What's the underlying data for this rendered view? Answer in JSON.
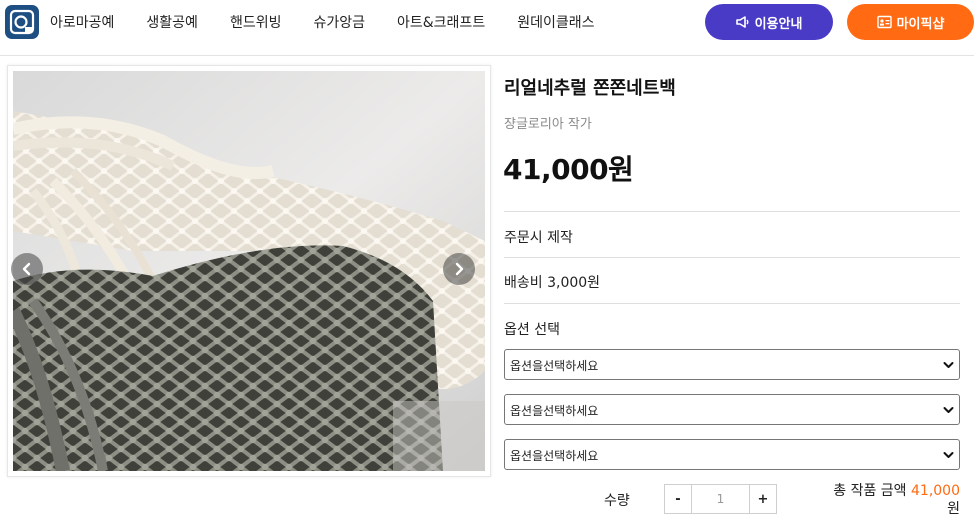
{
  "header": {
    "logo_icon": "camera-frame-icon",
    "nav": [
      "아로마공예",
      "생활공예",
      "핸드위빙",
      "슈가앙금",
      "아트&크래프트",
      "원데이클래스"
    ],
    "info_button": {
      "label": "이용안내",
      "icon": "megaphone-icon",
      "color": "#4a3bc6"
    },
    "mypick_button": {
      "label": "마이픽샵",
      "icon": "id-card-icon",
      "color": "#ff6a12"
    }
  },
  "gallery": {
    "prev_icon": "chevron-left-icon",
    "next_icon": "chevron-right-icon"
  },
  "product": {
    "title": "리얼네추럴 쫀쫀네트백",
    "artist": "쟝글로리아 작가",
    "price": "41,000원",
    "production": "주문시 제작",
    "shipping": "배송비 3,000원",
    "option_heading": "옵션 선택",
    "option_selects": [
      {
        "value": "옵션을선택하세요"
      },
      {
        "value": "옵션을선택하세요"
      },
      {
        "value": "옵션을선택하세요"
      }
    ]
  },
  "order": {
    "quantity_label": "수량",
    "minus_label": "-",
    "plus_label": "+",
    "quantity_value": "1",
    "total_label": "총 작품 금액",
    "total_amount": "41,000",
    "total_unit": "원"
  },
  "colors": {
    "accent_orange": "#ff6a12",
    "accent_purple": "#4a3bc6",
    "logo_blue": "#1d4f82"
  }
}
